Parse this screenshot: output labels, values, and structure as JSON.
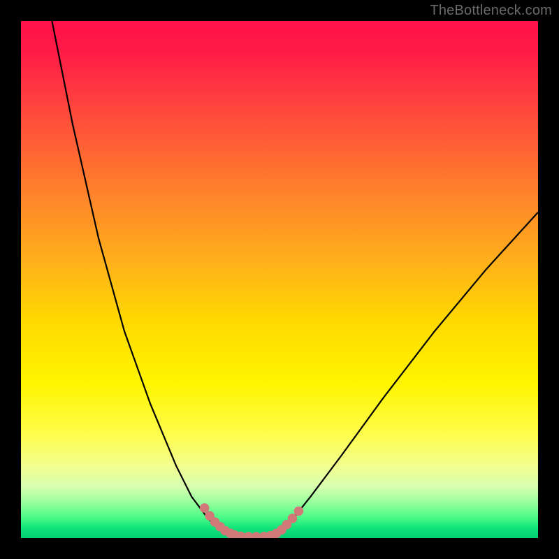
{
  "watermark": "TheBottleneck.com",
  "chart_data": {
    "type": "line",
    "title": "",
    "xlabel": "",
    "ylabel": "",
    "xlim": [
      0,
      100
    ],
    "ylim": [
      0,
      100
    ],
    "series": [
      {
        "name": "curve-left",
        "x": [
          6,
          10,
          15,
          20,
          25,
          30,
          33,
          36,
          38,
          40,
          41
        ],
        "y": [
          100,
          80,
          58,
          40,
          26,
          14,
          8,
          4,
          2,
          1,
          0.5
        ]
      },
      {
        "name": "curve-bottom",
        "x": [
          41,
          43,
          45,
          47,
          49
        ],
        "y": [
          0.5,
          0.2,
          0.2,
          0.2,
          0.5
        ]
      },
      {
        "name": "curve-right",
        "x": [
          49,
          52,
          56,
          62,
          70,
          80,
          90,
          100
        ],
        "y": [
          0.5,
          3,
          8,
          16,
          27,
          40,
          52,
          63
        ]
      },
      {
        "name": "dot-band-left",
        "x": [
          35.5,
          36.5,
          37.5,
          38.5,
          39.5,
          40.5,
          41.3
        ],
        "y": [
          5.8,
          4.3,
          3.1,
          2.2,
          1.4,
          0.9,
          0.6
        ]
      },
      {
        "name": "dot-band-bottom",
        "x": [
          42.5,
          44.0,
          45.5,
          47.0,
          48.3
        ],
        "y": [
          0.35,
          0.28,
          0.26,
          0.3,
          0.45
        ]
      },
      {
        "name": "dot-band-right",
        "x": [
          49.4,
          50.4,
          51.4,
          52.5,
          53.7
        ],
        "y": [
          0.9,
          1.6,
          2.6,
          3.8,
          5.2
        ]
      }
    ],
    "colors": {
      "curve": "#000000",
      "dots": "#d17878"
    }
  }
}
